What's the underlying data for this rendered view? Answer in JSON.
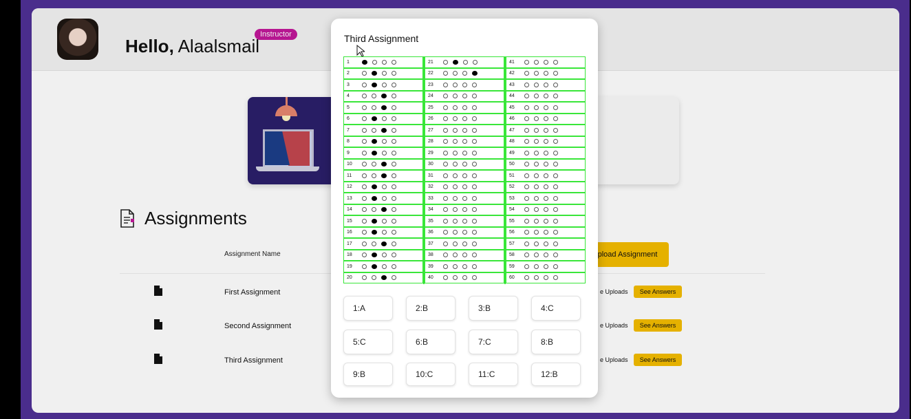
{
  "header": {
    "greeting_bold": "Hello,",
    "user_name": "Alaalsmail",
    "role_badge": "Instructor"
  },
  "section": {
    "title": "Assignments",
    "column_name": "Assignment Name",
    "upload_button": "pload Assignment",
    "uploads_label": "e Uploads",
    "see_answers_label": "See Answers"
  },
  "assignments": [
    {
      "name": "First Assignment"
    },
    {
      "name": "Second Assignment"
    },
    {
      "name": "Third Assignment"
    }
  ],
  "modal": {
    "title": "Third Assignment",
    "sheet_rows": [
      {
        "n": "1",
        "mark": 0
      },
      {
        "n": "2",
        "mark": 1
      },
      {
        "n": "3",
        "mark": 1
      },
      {
        "n": "4",
        "mark": 2
      },
      {
        "n": "5",
        "mark": 2
      },
      {
        "n": "6",
        "mark": 1
      },
      {
        "n": "7",
        "mark": 2
      },
      {
        "n": "8",
        "mark": 1
      },
      {
        "n": "9",
        "mark": 1
      },
      {
        "n": "10",
        "mark": 2
      },
      {
        "n": "11",
        "mark": 2
      },
      {
        "n": "12",
        "mark": 1
      },
      {
        "n": "13",
        "mark": 1
      },
      {
        "n": "14",
        "mark": 2
      },
      {
        "n": "15",
        "mark": 1
      },
      {
        "n": "16",
        "mark": 1
      },
      {
        "n": "17",
        "mark": 2
      },
      {
        "n": "18",
        "mark": 1
      },
      {
        "n": "19",
        "mark": 1
      },
      {
        "n": "20",
        "mark": 2
      },
      {
        "n": "21",
        "mark": 1
      },
      {
        "n": "22",
        "mark": 3
      },
      {
        "n": "23",
        "mark": -1
      },
      {
        "n": "24",
        "mark": -1
      },
      {
        "n": "25",
        "mark": -1
      },
      {
        "n": "26",
        "mark": -1
      },
      {
        "n": "27",
        "mark": -1
      },
      {
        "n": "28",
        "mark": -1
      },
      {
        "n": "29",
        "mark": -1
      },
      {
        "n": "30",
        "mark": -1
      },
      {
        "n": "31",
        "mark": -1
      },
      {
        "n": "32",
        "mark": -1
      },
      {
        "n": "33",
        "mark": -1
      },
      {
        "n": "34",
        "mark": -1
      },
      {
        "n": "35",
        "mark": -1
      },
      {
        "n": "36",
        "mark": -1
      },
      {
        "n": "37",
        "mark": -1
      },
      {
        "n": "38",
        "mark": -1
      },
      {
        "n": "39",
        "mark": -1
      },
      {
        "n": "40",
        "mark": -1
      },
      {
        "n": "41",
        "mark": -1
      },
      {
        "n": "42",
        "mark": -1
      },
      {
        "n": "43",
        "mark": -1
      },
      {
        "n": "44",
        "mark": -1
      },
      {
        "n": "45",
        "mark": -1
      },
      {
        "n": "46",
        "mark": -1
      },
      {
        "n": "47",
        "mark": -1
      },
      {
        "n": "48",
        "mark": -1
      },
      {
        "n": "49",
        "mark": -1
      },
      {
        "n": "50",
        "mark": -1
      },
      {
        "n": "51",
        "mark": -1
      },
      {
        "n": "52",
        "mark": -1
      },
      {
        "n": "53",
        "mark": -1
      },
      {
        "n": "54",
        "mark": -1
      },
      {
        "n": "55",
        "mark": -1
      },
      {
        "n": "56",
        "mark": -1
      },
      {
        "n": "57",
        "mark": -1
      },
      {
        "n": "58",
        "mark": -1
      },
      {
        "n": "59",
        "mark": -1
      },
      {
        "n": "60",
        "mark": -1
      }
    ],
    "answers": [
      "1:A",
      "2:B",
      "3:B",
      "4:C",
      "5:C",
      "6:B",
      "7:C",
      "8:B",
      "9:B",
      "10:C",
      "11:C",
      "12:B"
    ]
  },
  "colors": {
    "frame": "#4a2d8c",
    "accent": "#f4bd00",
    "badge": "#c2189b",
    "sheet_grid": "#39e639"
  }
}
